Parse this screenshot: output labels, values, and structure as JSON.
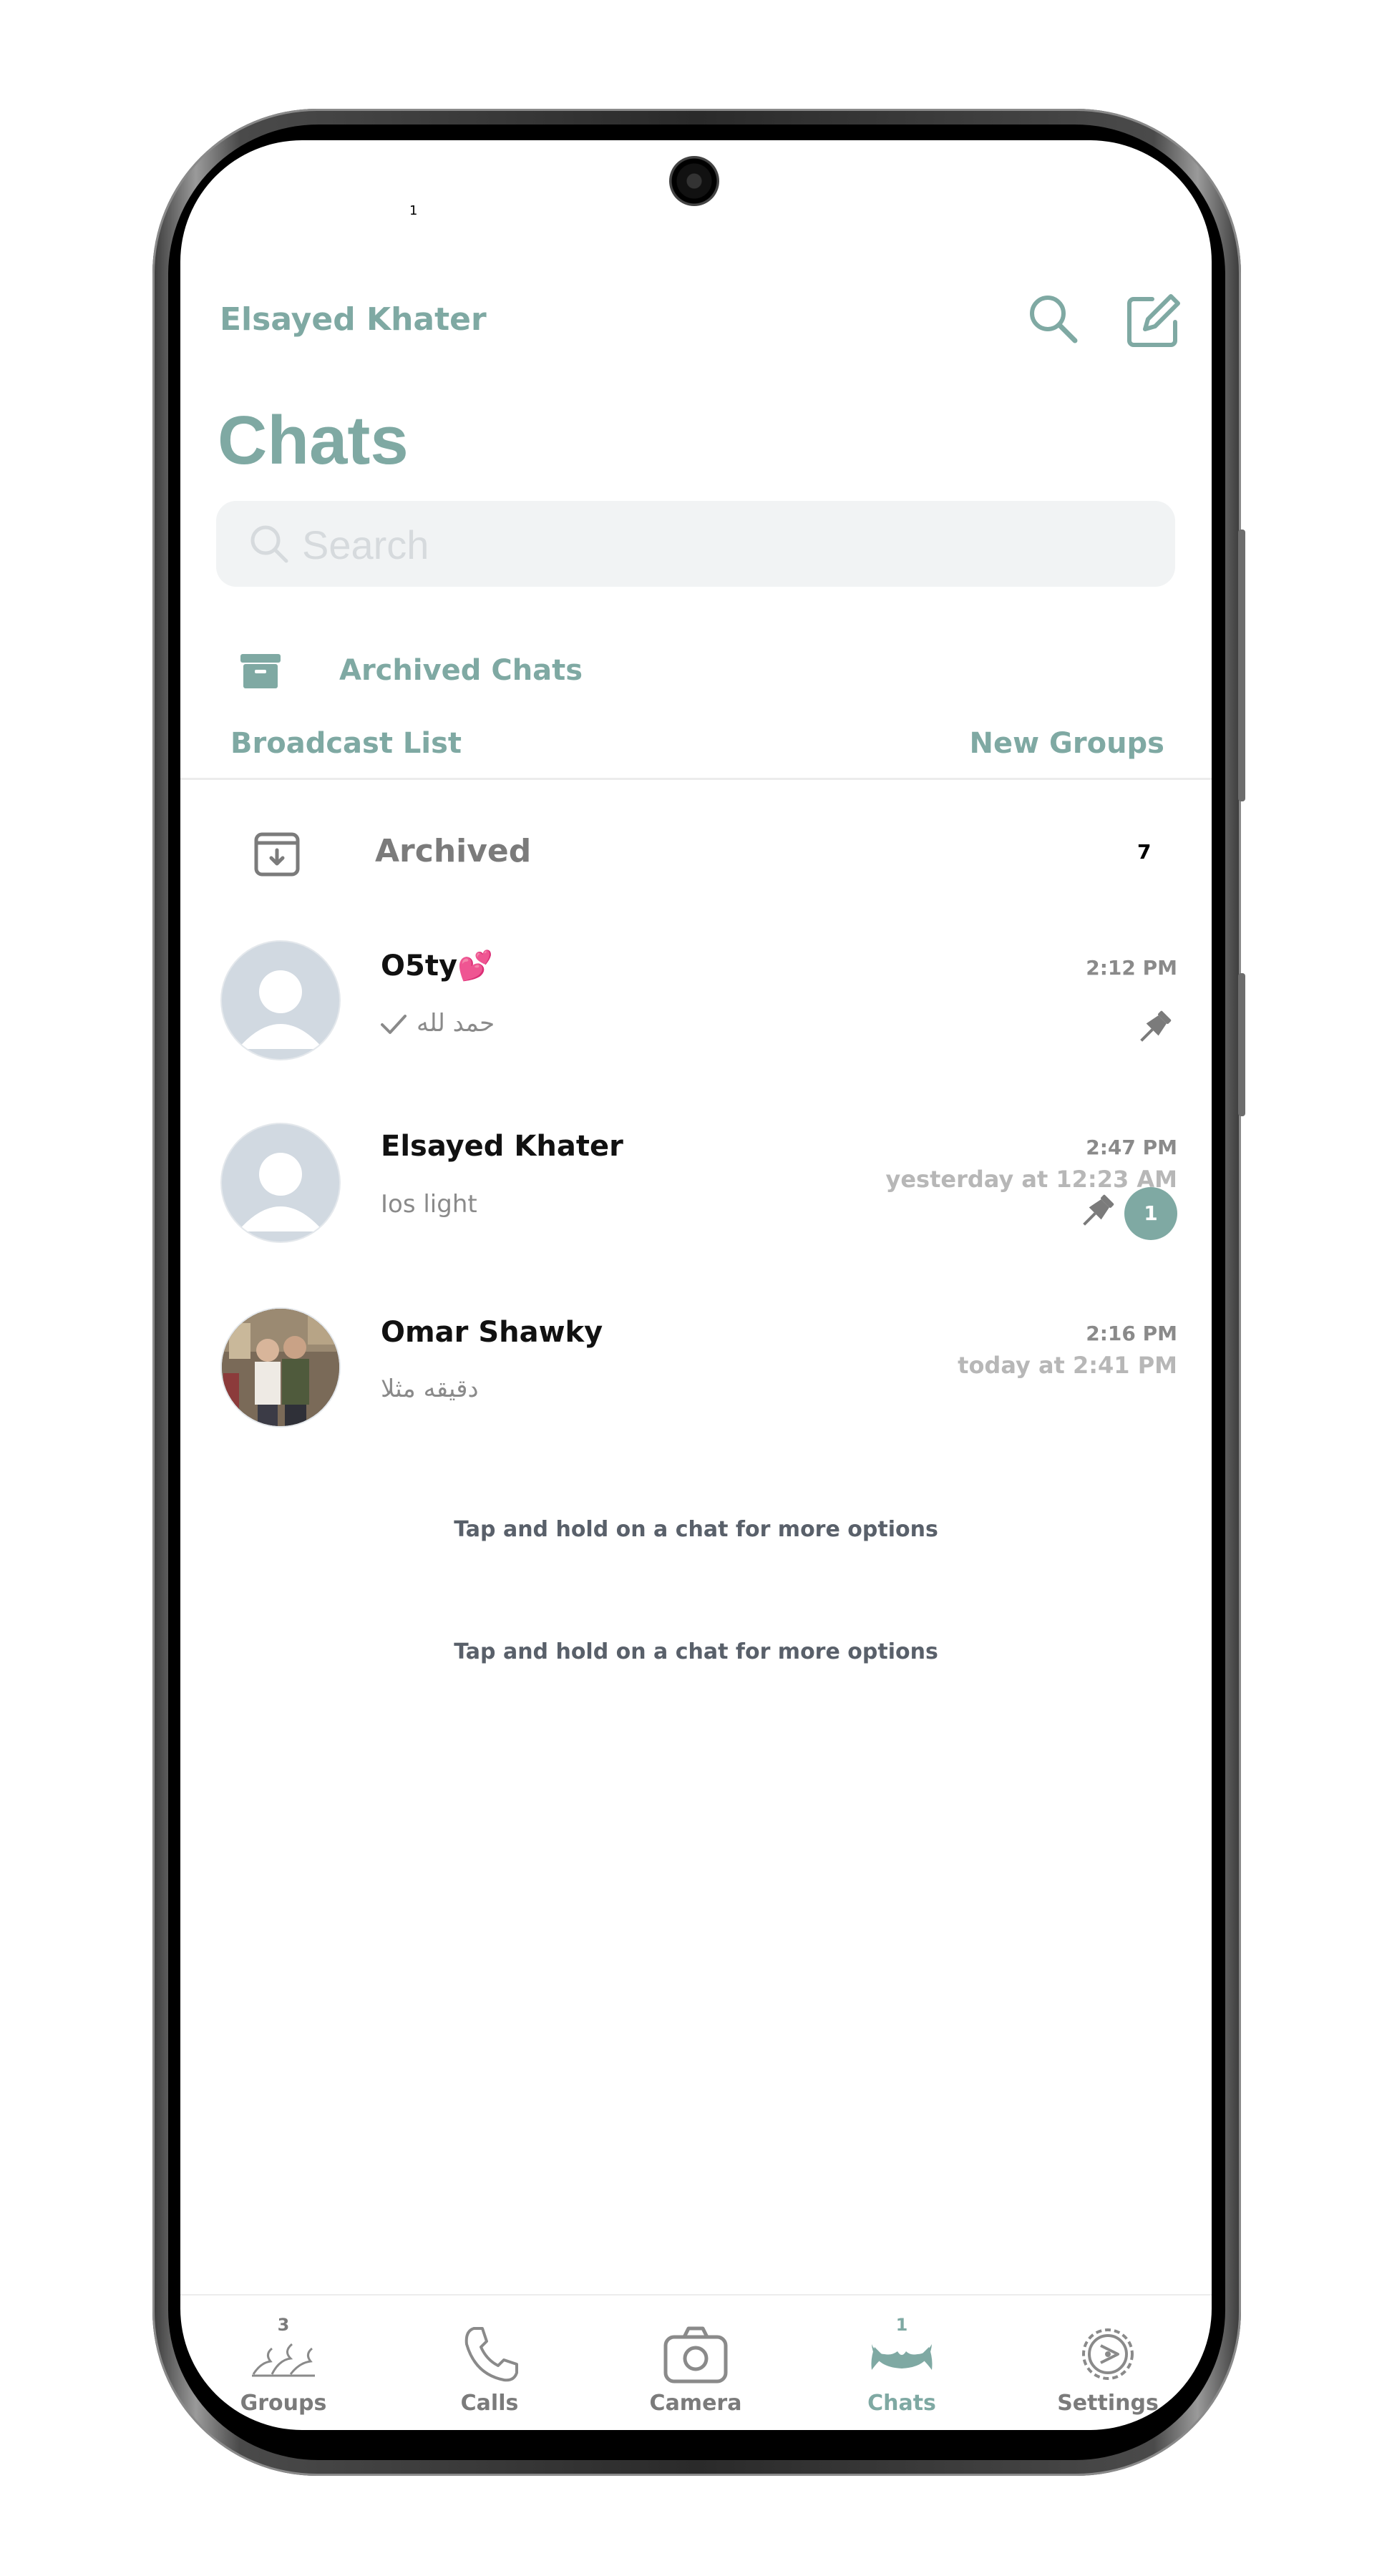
{
  "status_bar": {
    "indicator": "1"
  },
  "header": {
    "user_name": "Elsayed Khater",
    "title": "Chats",
    "search_icon": "search-icon",
    "compose_icon": "compose-icon"
  },
  "search": {
    "placeholder": "Search",
    "value": ""
  },
  "archived_chats": {
    "label": "Archived Chats",
    "icon": "archive-box-icon"
  },
  "links": {
    "broadcast": "Broadcast List",
    "new_groups": "New Groups"
  },
  "archived_row": {
    "label": "Archived",
    "count": "7",
    "icon": "archive-icon"
  },
  "chats": [
    {
      "name": "O5ty💕",
      "message": "حمد لله",
      "time": "2:12 PM",
      "subtext": "",
      "pinned": true,
      "unread": "",
      "read_check": true
    },
    {
      "name": "Elsayed Khater",
      "message": "Ios light",
      "time": "2:47 PM",
      "subtext": "yesterday at 12:23 AM",
      "pinned": true,
      "unread": "1",
      "read_check": false
    },
    {
      "name": "Omar Shawky",
      "message": "دقيقه مثلا",
      "time": "2:16 PM",
      "subtext": "today at 2:41 PM",
      "pinned": false,
      "unread": "",
      "read_check": false
    }
  ],
  "hints": [
    "Tap and hold on a chat for more options",
    "Tap and hold on a chat for more options"
  ],
  "tabs": [
    {
      "label": "Groups",
      "badge": "3",
      "icon": "groups-icon"
    },
    {
      "label": "Calls",
      "badge": "",
      "icon": "phone-icon"
    },
    {
      "label": "Camera",
      "badge": "",
      "icon": "camera-icon"
    },
    {
      "label": "Chats",
      "badge": "1",
      "icon": "chats-icon",
      "active": true
    },
    {
      "label": "Settings",
      "badge": "",
      "icon": "gear-icon"
    }
  ],
  "colors": {
    "accent": "#7fa9a3",
    "muted": "#8a8a8a",
    "avatar_bg": "#d1d9e1"
  }
}
